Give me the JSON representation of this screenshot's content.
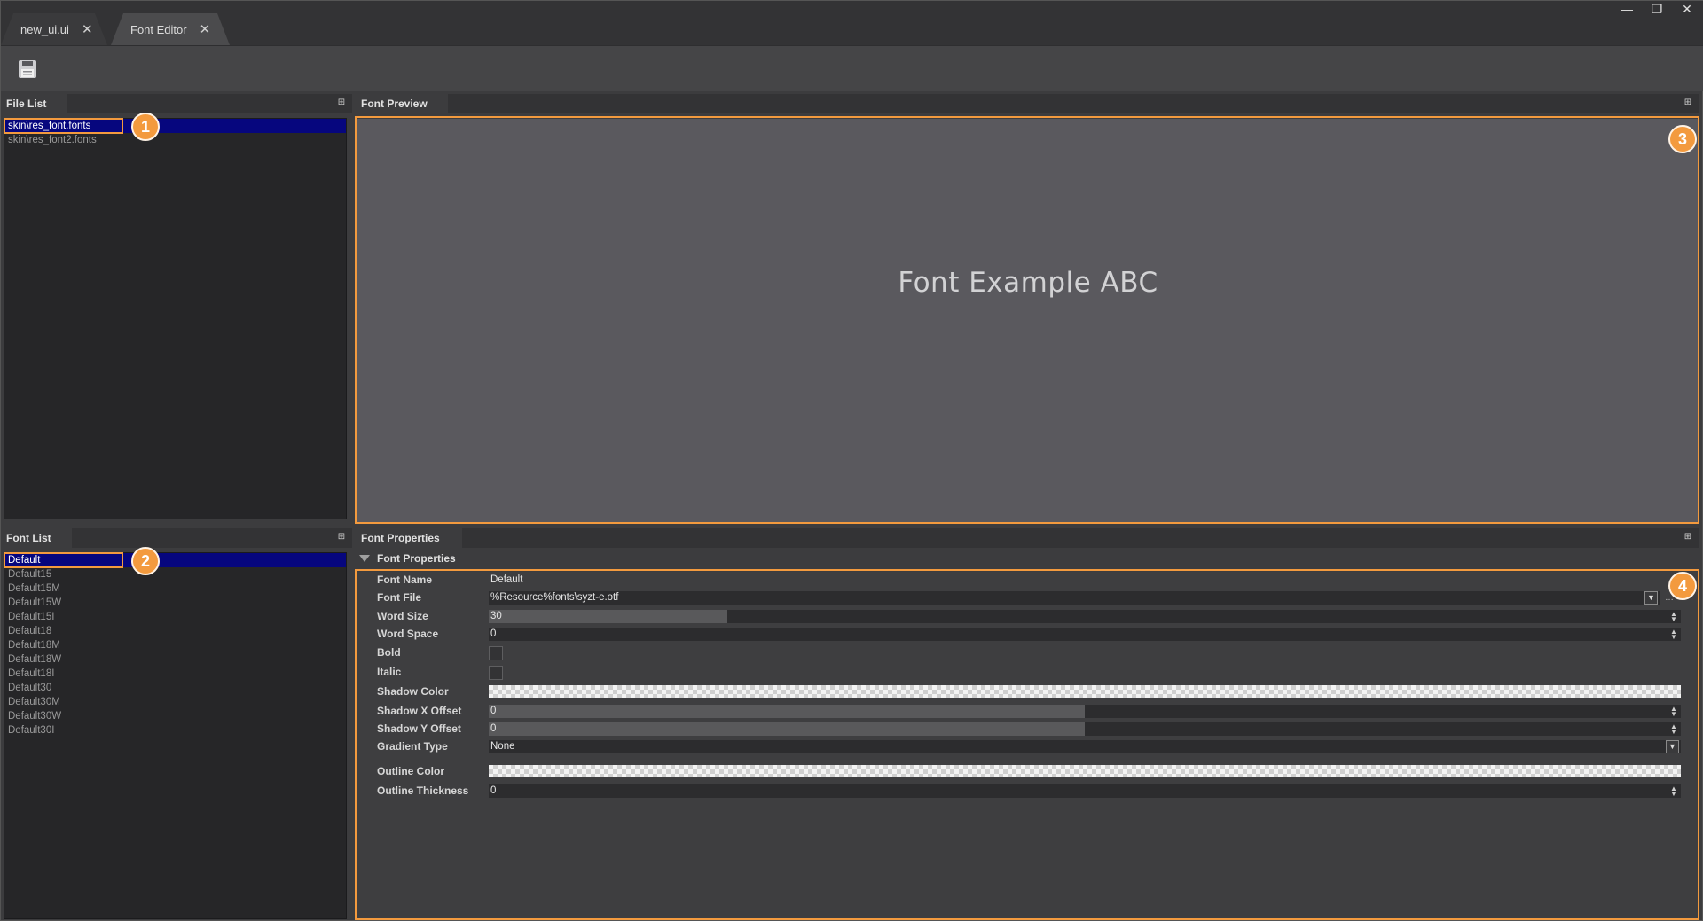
{
  "tabs": [
    {
      "label": "new_ui.ui"
    },
    {
      "label": "Font Editor"
    }
  ],
  "window_controls": {
    "minimize": "—",
    "restore": "❐",
    "close": "✕"
  },
  "panels": {
    "file_list": {
      "title": "File List",
      "items": [
        {
          "label": "skin\\res_font.fonts"
        },
        {
          "label": "skin\\res_font2.fonts"
        }
      ]
    },
    "font_preview": {
      "title": "Font Preview",
      "sample_text": "Font Example ABC"
    },
    "font_list": {
      "title": "Font List",
      "items": [
        {
          "label": "Default"
        },
        {
          "label": "Default15"
        },
        {
          "label": "Default15M"
        },
        {
          "label": "Default15W"
        },
        {
          "label": "Default15I"
        },
        {
          "label": "Default18"
        },
        {
          "label": "Default18M"
        },
        {
          "label": "Default18W"
        },
        {
          "label": "Default18I"
        },
        {
          "label": "Default30"
        },
        {
          "label": "Default30M"
        },
        {
          "label": "Default30W"
        },
        {
          "label": "Default30I"
        }
      ]
    },
    "font_properties": {
      "title": "Font Properties",
      "section": "Font Properties",
      "rows": {
        "font_name": {
          "label": "Font Name",
          "value": "Default"
        },
        "font_file": {
          "label": "Font File",
          "value": "%Resource%fonts\\syzt-e.otf"
        },
        "word_size": {
          "label": "Word Size",
          "value": "30"
        },
        "word_space": {
          "label": "Word Space",
          "value": "0"
        },
        "bold": {
          "label": "Bold",
          "checked": false
        },
        "italic": {
          "label": "Italic",
          "checked": false
        },
        "shadow_color": {
          "label": "Shadow Color"
        },
        "shadow_x": {
          "label": "Shadow X Offset",
          "value": "0"
        },
        "shadow_y": {
          "label": "Shadow Y Offset",
          "value": "0"
        },
        "gradient_type": {
          "label": "Gradient Type",
          "value": "None"
        },
        "outline_color": {
          "label": "Outline Color"
        },
        "outline_thickness": {
          "label": "Outline Thickness",
          "value": "0"
        }
      }
    }
  },
  "callouts": [
    "1",
    "2",
    "3",
    "4"
  ],
  "colors": {
    "accent": "#f39a3e",
    "selection": "#06067e"
  }
}
